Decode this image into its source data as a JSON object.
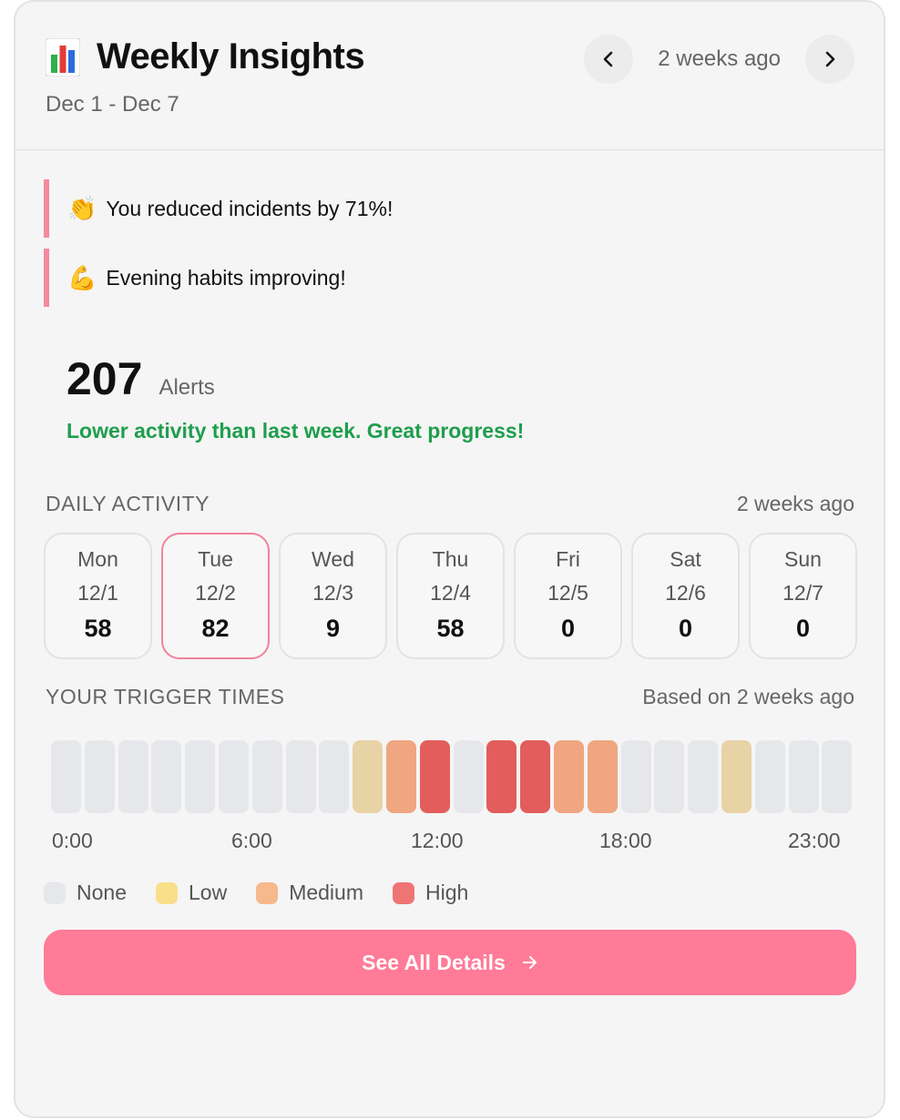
{
  "header": {
    "icon": "bar-chart-icon",
    "title": "Weekly Insights",
    "date_range": "Dec 1 - Dec 7",
    "period_label": "2 weeks ago"
  },
  "insights": [
    {
      "emoji": "👏",
      "text": "You reduced incidents by 71%!"
    },
    {
      "emoji": "💪",
      "text": "Evening habits improving!"
    }
  ],
  "summary": {
    "count": "207",
    "unit": "Alerts",
    "message": "Lower activity than last week. Great progress!",
    "message_color": "#1f9e4d"
  },
  "daily_activity": {
    "title": "DAILY ACTIVITY",
    "period": "2 weeks ago",
    "days": [
      {
        "day": "Mon",
        "date": "12/1",
        "value": "58"
      },
      {
        "day": "Tue",
        "date": "12/2",
        "value": "82",
        "selected": true
      },
      {
        "day": "Wed",
        "date": "12/3",
        "value": "9"
      },
      {
        "day": "Thu",
        "date": "12/4",
        "value": "58"
      },
      {
        "day": "Fri",
        "date": "12/5",
        "value": "0"
      },
      {
        "day": "Sat",
        "date": "12/6",
        "value": "0"
      },
      {
        "day": "Sun",
        "date": "12/7",
        "value": "0"
      }
    ]
  },
  "trigger_times": {
    "title": "YOUR TRIGGER TIMES",
    "basis": "Based on 2 weeks ago",
    "hour_levels": [
      "none",
      "none",
      "none",
      "none",
      "none",
      "none",
      "none",
      "none",
      "none",
      "low",
      "medium",
      "high",
      "none",
      "high",
      "high",
      "medium",
      "medium",
      "none",
      "none",
      "none",
      "low",
      "none",
      "none",
      "none"
    ],
    "axis_labels": [
      "0:00",
      "6:00",
      "12:00",
      "18:00",
      "23:00"
    ],
    "legend": [
      {
        "key": "none",
        "label": "None",
        "color": "#e6e7ea"
      },
      {
        "key": "low",
        "label": "Low",
        "color": "#f9df8a"
      },
      {
        "key": "medium",
        "label": "Medium",
        "color": "#f6b98c"
      },
      {
        "key": "high",
        "label": "High",
        "color": "#ef7575"
      }
    ],
    "cell_colors": {
      "none": "#e6e7ea",
      "low": "#e8d3a6",
      "medium": "#f0a680",
      "high": "#e35d5d"
    }
  },
  "cta": {
    "label": "See All Details",
    "color": "#ff7b97"
  }
}
